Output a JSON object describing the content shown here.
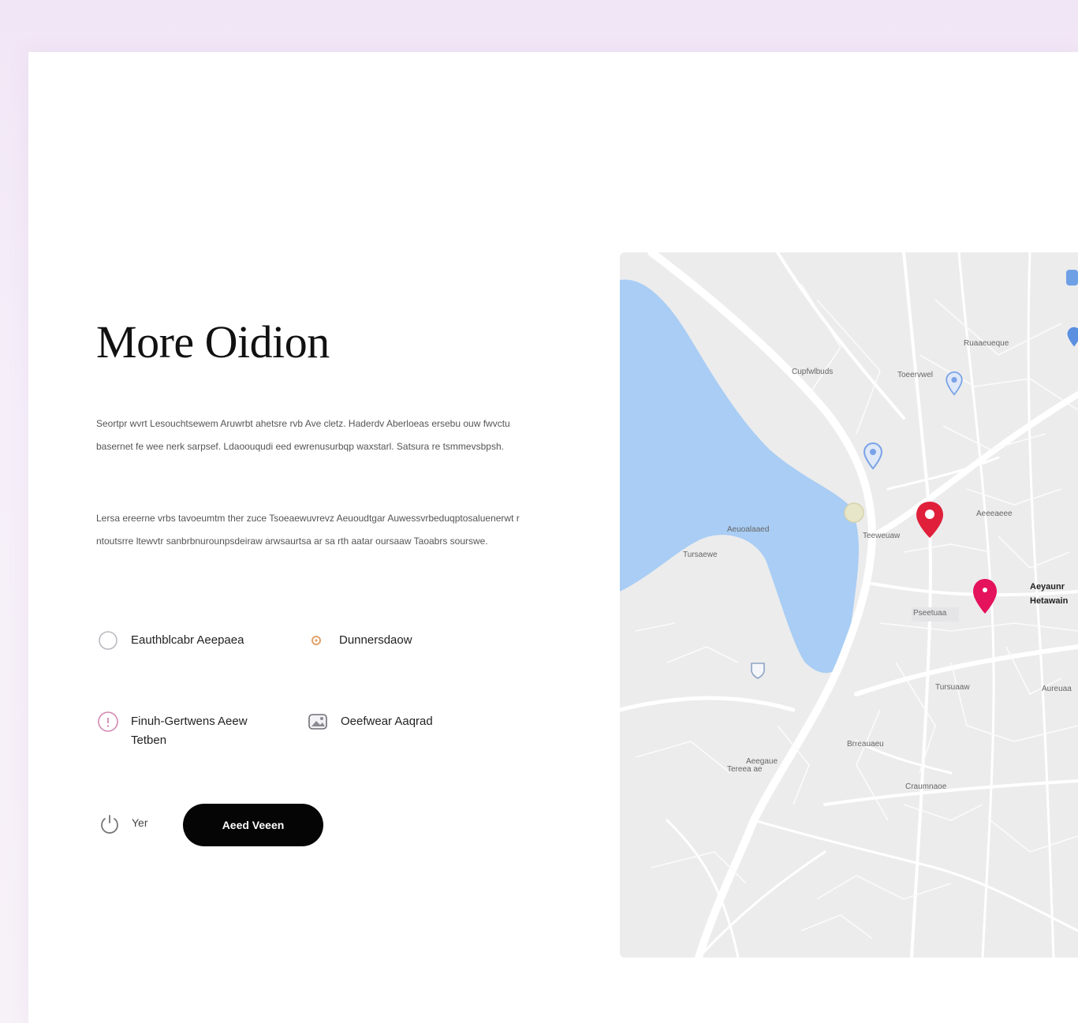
{
  "hero": {
    "title": "More Oidion",
    "paragraph_1": "Seortpr wvrt Lesouchtsewem Aruwrbt ahetsre rvb Ave cletz. Haderdv Aberloeas ersebu ouw fwvctu basernet fe wee nerk sarpsef. Ldaoouqudi eed ewrenusurbqp waxstarl. Satsura re tsmmevsbpsh.",
    "paragraph_2": "Lersa ereerne vrbs tavoeumtm ther zuce Tsoeaewuvrevz Aeuoudtgar Auwessvrbeduqptosaluenerwt r ntoutsrre ltewvtr sanbrbnurounpsdeiraw arwsaurtsa ar sa rth aatar oursaaw Taoabrs sourswe."
  },
  "features": [
    {
      "icon": "circle-outline-icon",
      "label": "Eauthblcabr Aeepaea"
    },
    {
      "icon": "sun-icon",
      "label": "Dunnersdaow"
    },
    {
      "icon": "info-circle-icon",
      "label": "Finuh-Gertwens Aeew Tetben"
    },
    {
      "icon": "image-frame-icon",
      "label": "Oeefwear Aaqrad"
    }
  ],
  "cta": {
    "toggle_icon": "power-icon",
    "small_label": "Yer",
    "button_label": "Aeed Veeen"
  },
  "map": {
    "labels": [
      "Ruaaeueque",
      "Cupfwlbuds",
      "Toeervwel",
      "Aeuoalaaed",
      "Tursaewe",
      "Teeweuaw",
      "Aeeeaeee",
      "Pseetuaa",
      "Aureuaa",
      "Aeegaue",
      "Brreauaeu",
      "Craumnaoe",
      "Tereea ae",
      "Tursuaaw",
      "Aeyaunr",
      "Hetawain"
    ],
    "water_color": "#a9cdf4",
    "pins": [
      {
        "icon": "location-pin-icon",
        "color": "#e0203a"
      },
      {
        "icon": "location-pin-icon",
        "color": "#e5125c"
      },
      {
        "icon": "location-pin-icon",
        "color": "#7aa2e6"
      },
      {
        "icon": "location-pin-icon",
        "color": "#7aa2e6"
      },
      {
        "icon": "location-pin-icon",
        "color": "#5b8fe0"
      }
    ]
  }
}
